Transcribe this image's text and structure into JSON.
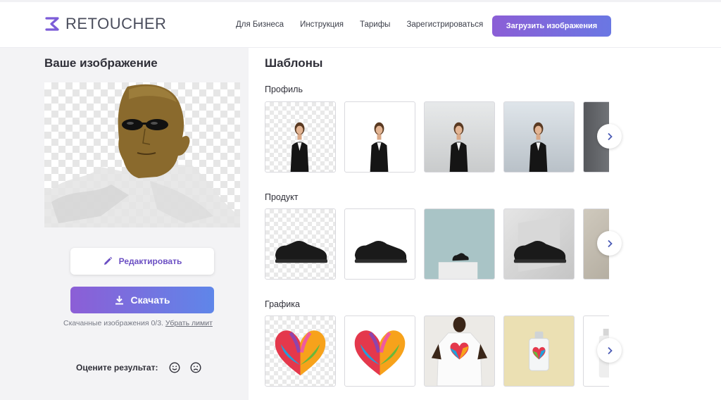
{
  "header": {
    "logo_text": "RETOUCHER",
    "nav": [
      "Для Бизнеса",
      "Инструкция",
      "Тарифы",
      "Зарегистрироваться"
    ],
    "upload_label": "Загрузить изображения"
  },
  "left": {
    "title": "Ваше изображение",
    "edit_label": "Редактировать",
    "download_label": "Скачать",
    "limit_text": "Скачанные изображения 0/3.",
    "limit_link": "Убрать лимит",
    "rate_label": "Оцените результат:",
    "icons": [
      "pencil-icon",
      "download-icon",
      "smile-icon",
      "frown-icon"
    ]
  },
  "right": {
    "title": "Шаблоны",
    "sections": [
      {
        "label": "Профиль"
      },
      {
        "label": "Продукт"
      },
      {
        "label": "Графика"
      }
    ],
    "next_icon": "chevron-right-icon"
  },
  "colors": {
    "accent_start": "#8b5ed6",
    "accent_end": "#6a77e3",
    "left_bg": "#f3f3f5"
  }
}
